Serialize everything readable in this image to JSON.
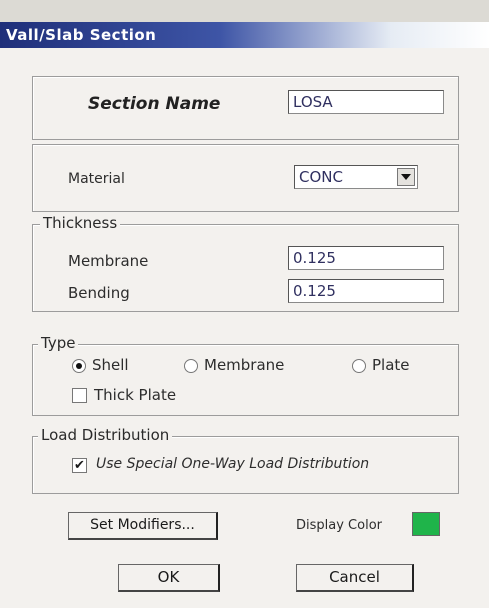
{
  "window": {
    "title": "Vall/Slab Section"
  },
  "section_name": {
    "label": "Section Name",
    "value": "LOSA"
  },
  "material": {
    "label": "Material",
    "value": "CONC"
  },
  "thickness": {
    "group_label": "Thickness",
    "membrane_label": "Membrane",
    "membrane_value": "0.125",
    "bending_label": "Bending",
    "bending_value": "0.125"
  },
  "type": {
    "group_label": "Type",
    "options": [
      "Shell",
      "Membrane",
      "Plate"
    ],
    "selected": "Shell",
    "thick_plate_label": "Thick Plate",
    "thick_plate_checked": false
  },
  "load_distribution": {
    "group_label": "Load Distribution",
    "checkbox_label": "Use Special One-Way Load Distribution",
    "checked": true
  },
  "buttons": {
    "set_modifiers": "Set Modifiers...",
    "ok": "OK",
    "cancel": "Cancel"
  },
  "display_color": {
    "label": "Display Color",
    "color": "#1fb44a"
  }
}
